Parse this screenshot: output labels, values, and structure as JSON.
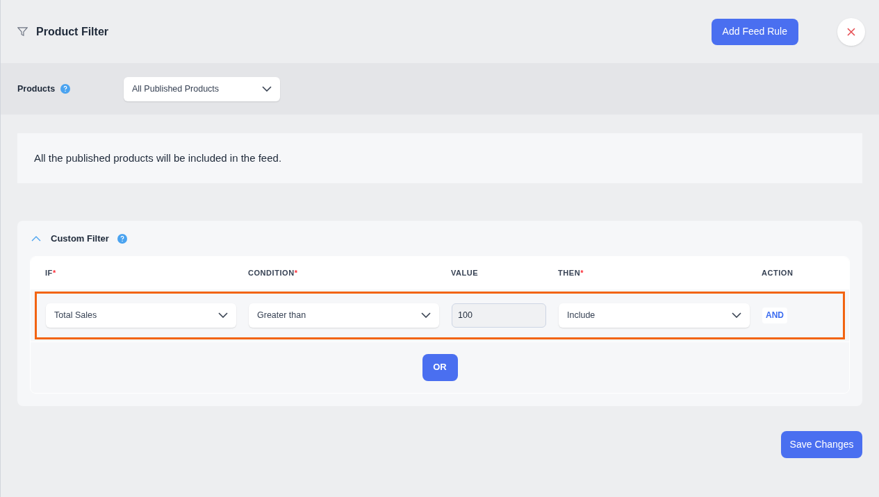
{
  "header": {
    "title": "Product Filter",
    "add_button": "Add Feed Rule"
  },
  "products": {
    "label": "Products",
    "selected_option": "All Published Products"
  },
  "notice": "All the published products will be included in the feed.",
  "custom_filter": {
    "title": "Custom Filter",
    "expanded": true,
    "columns": [
      {
        "label": "IF",
        "required_mark": "*"
      },
      {
        "label": "CONDITION",
        "required_mark": "*"
      },
      {
        "label": "VALUE"
      },
      {
        "label": "THEN",
        "required_mark": "*"
      },
      {
        "label": "ACTION"
      }
    ],
    "rules": [
      {
        "highlighted": true,
        "if": "Total Sales",
        "condition": "Greater than",
        "value": "100",
        "then": "Include",
        "action": "AND"
      }
    ],
    "or_button": "OR"
  },
  "save_button": "Save Changes"
}
